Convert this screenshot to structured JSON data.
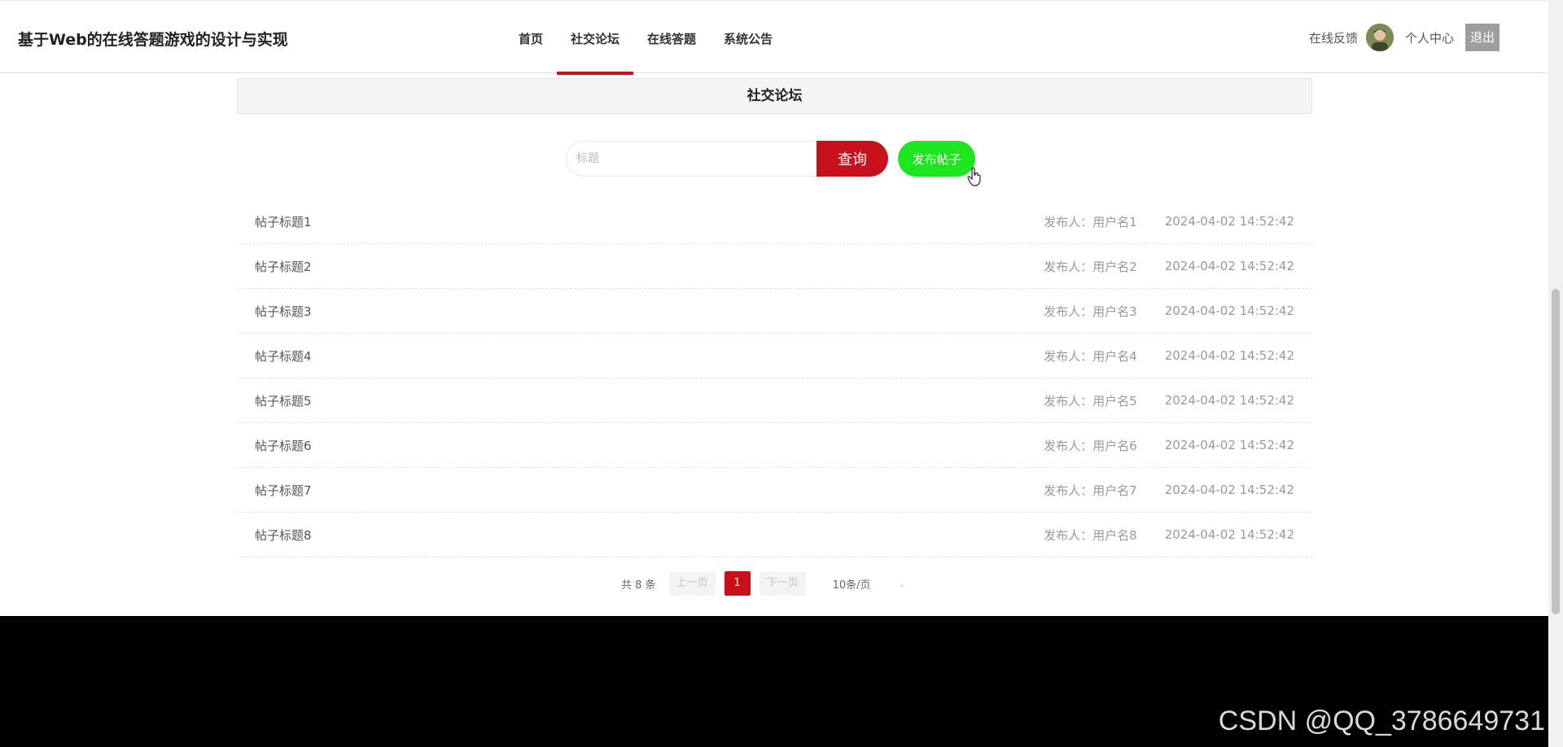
{
  "header": {
    "site_title": "基于Web的在线答题游戏的设计与实现",
    "nav": [
      {
        "label": "首页",
        "active": false
      },
      {
        "label": "社交论坛",
        "active": true
      },
      {
        "label": "在线答题",
        "active": false
      },
      {
        "label": "系统公告",
        "active": false
      }
    ],
    "feedback_label": "在线反馈",
    "profile_label": "个人中心",
    "logout_label": "退出"
  },
  "section": {
    "title": "社交论坛"
  },
  "search": {
    "placeholder": "标题",
    "value": "",
    "query_label": "查询",
    "publish_label": "发布帖子"
  },
  "posts": [
    {
      "title": "帖子标题1",
      "author": "发布人：用户名1",
      "time": "2024-04-02 14:52:42"
    },
    {
      "title": "帖子标题2",
      "author": "发布人：用户名2",
      "time": "2024-04-02 14:52:42"
    },
    {
      "title": "帖子标题3",
      "author": "发布人：用户名3",
      "time": "2024-04-02 14:52:42"
    },
    {
      "title": "帖子标题4",
      "author": "发布人：用户名4",
      "time": "2024-04-02 14:52:42"
    },
    {
      "title": "帖子标题5",
      "author": "发布人：用户名5",
      "time": "2024-04-02 14:52:42"
    },
    {
      "title": "帖子标题6",
      "author": "发布人：用户名6",
      "time": "2024-04-02 14:52:42"
    },
    {
      "title": "帖子标题7",
      "author": "发布人：用户名7",
      "time": "2024-04-02 14:52:42"
    },
    {
      "title": "帖子标题8",
      "author": "发布人：用户名8",
      "time": "2024-04-02 14:52:42"
    }
  ],
  "pagination": {
    "total_text": "共 8 条",
    "prev_label": "上一页",
    "current_page": "1",
    "next_label": "下一页",
    "page_size": "10条/页"
  },
  "watermark": "CSDN @QQ_3786649731",
  "colors": {
    "accent": "#c8101d",
    "publish": "#1ee61e",
    "footer": "#000000"
  }
}
